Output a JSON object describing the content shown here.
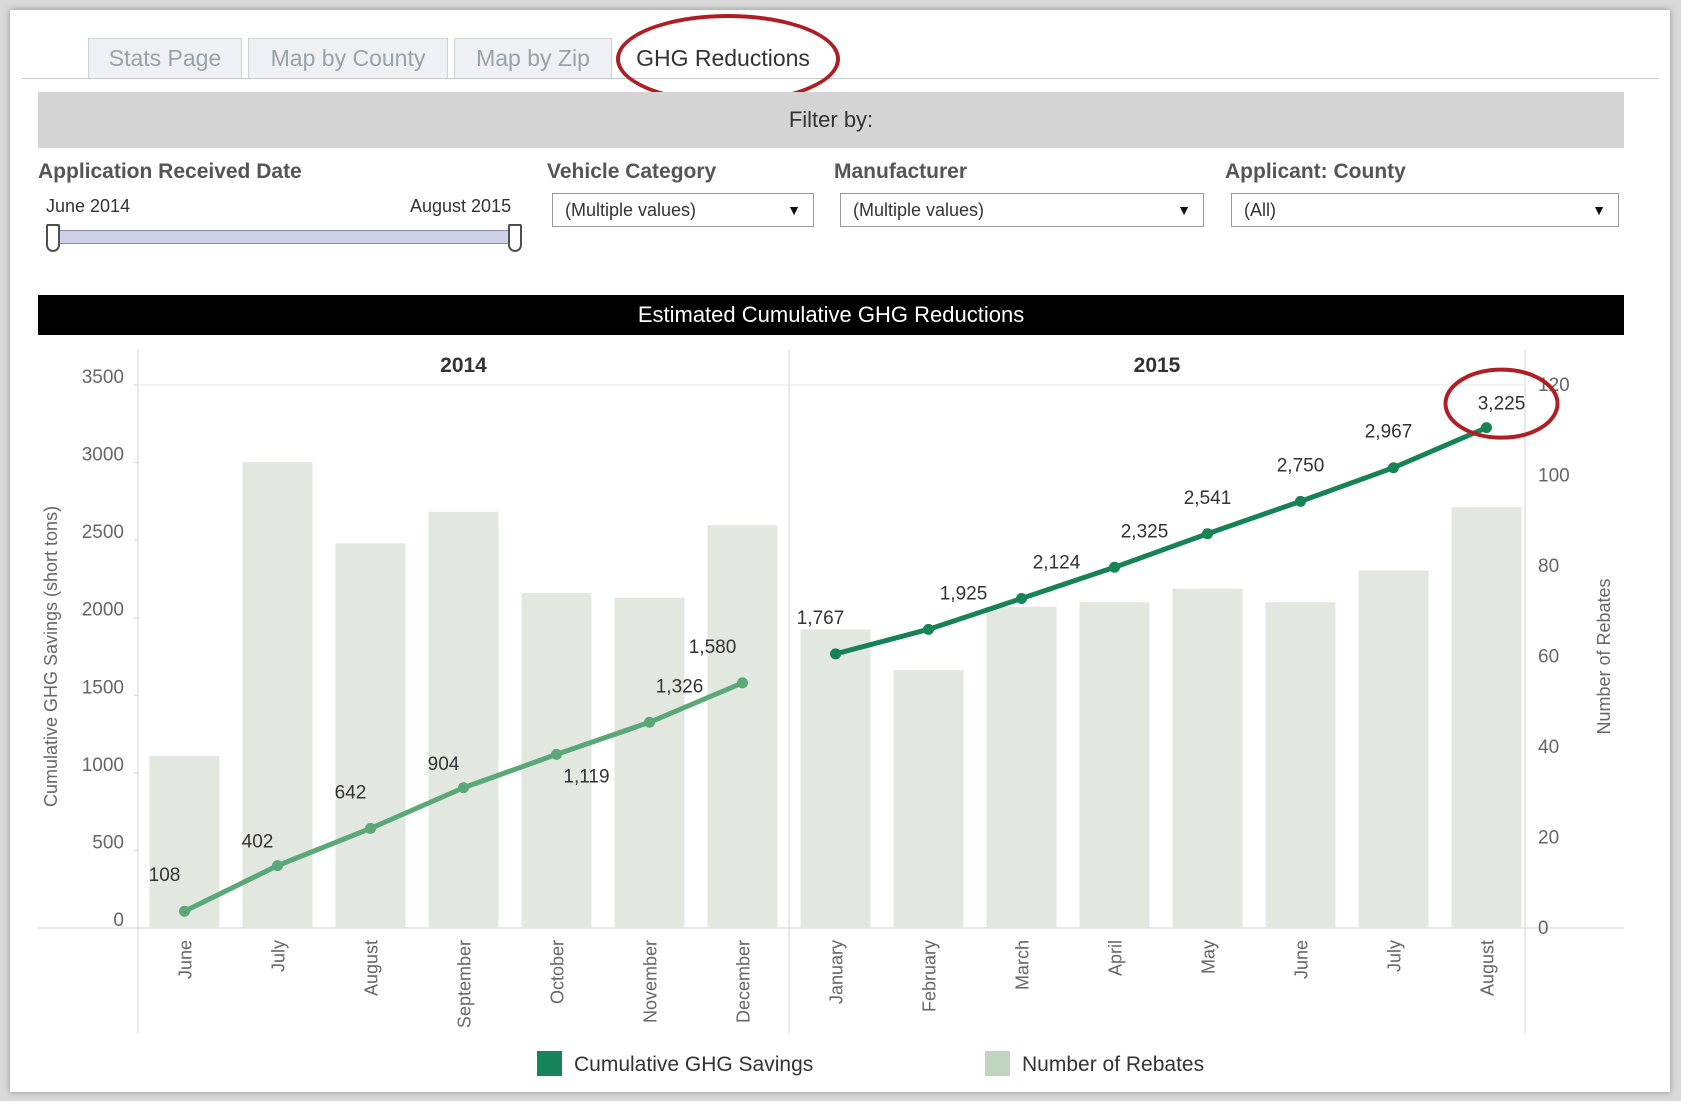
{
  "tabs": [
    {
      "label": "Stats Page"
    },
    {
      "label": "Map by County"
    },
    {
      "label": "Map by Zip"
    },
    {
      "label": "GHG Reductions"
    }
  ],
  "filter_bar": {
    "label": "Filter by:"
  },
  "filters": {
    "date": {
      "label": "Application Received Date",
      "start": "June 2014",
      "end": "August 2015",
      "range_fraction": [
        0,
        1
      ]
    },
    "vehicle": {
      "label": "Vehicle Category",
      "value": "(Multiple values)"
    },
    "manufacturer": {
      "label": "Manufacturer",
      "value": "(Multiple values)"
    },
    "county": {
      "label": "Applicant: County",
      "value": "(All)"
    }
  },
  "colors": {
    "line_2014": "#5aa878",
    "line_2015": "#168356",
    "bars": "#e2e8e0",
    "highlight_ring": "#b01e24",
    "legend_line": "#16835a",
    "legend_bars": "#bfd5bd"
  },
  "chart_data": {
    "type": "bar",
    "title": "Estimated Cumulative GHG Reductions",
    "panels": [
      {
        "label": "2014",
        "categories": [
          "June",
          "July",
          "August",
          "September",
          "October",
          "November",
          "December"
        ]
      },
      {
        "label": "2015",
        "categories": [
          "January",
          "February",
          "March",
          "April",
          "May",
          "June",
          "July",
          "August"
        ]
      }
    ],
    "series": [
      {
        "name": "Cumulative GHG Savings",
        "chart_type": "line",
        "axis": "left",
        "values": [
          108,
          402,
          642,
          904,
          1119,
          1326,
          1580,
          1767,
          1925,
          2124,
          2325,
          2541,
          2750,
          2967,
          3225
        ],
        "labels": [
          "108",
          "402",
          "642",
          "904",
          "1,119",
          "1,326",
          "1,580",
          "1,767",
          "1,925",
          "2,124",
          "2,325",
          "2,541",
          "2,750",
          "2,967",
          "3,225"
        ]
      },
      {
        "name": "Number of Rebates",
        "chart_type": "bar",
        "axis": "right",
        "values": [
          38,
          103,
          85,
          92,
          74,
          73,
          89,
          66,
          57,
          71,
          72,
          75,
          72,
          79,
          93
        ]
      }
    ],
    "y_left": {
      "label": "Cumulative GHG Savings (short tons)",
      "ticks": [
        "0",
        "500",
        "1000",
        "1500",
        "2000",
        "2500",
        "3000",
        "3500"
      ],
      "range": [
        0,
        3500
      ]
    },
    "y_right": {
      "label": "Number of Rebates",
      "ticks": [
        "0",
        "20",
        "40",
        "60",
        "80",
        "100",
        "120"
      ],
      "range": [
        0,
        120
      ]
    },
    "highlighted_point": "3,225",
    "legend": [
      "Cumulative GHG Savings",
      "Number of Rebates"
    ],
    "legend_position": "bottom"
  }
}
